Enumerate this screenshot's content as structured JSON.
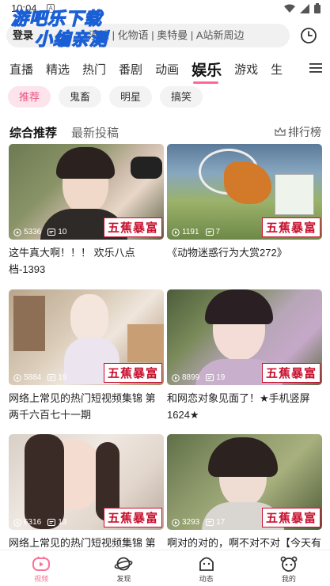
{
  "status_bar": {
    "time": "10:04",
    "notification_letter": "A"
  },
  "watermark": {
    "line1": "游吧乐下载",
    "line2": "小编亲测"
  },
  "search": {
    "login_label": "登录",
    "placeholder_text": "漫社 | 化物语 | 奥特曼 | A站新周边"
  },
  "nav_tabs": [
    "直播",
    "精选",
    "热门",
    "番剧",
    "动画",
    "娱乐",
    "游戏",
    "生"
  ],
  "active_nav_tab": "娱乐",
  "sub_tabs": [
    "推荐",
    "鬼畜",
    "明星",
    "搞笑"
  ],
  "section_tabs": [
    "综合推荐",
    "最新投稿"
  ],
  "rank_label": "排行榜",
  "cards": [
    {
      "views": "5336",
      "comments": "10",
      "brand": "五蕉暴富",
      "title_line1": "这牛真大啊！！！ 欢乐八点",
      "title_line2": "档-1393"
    },
    {
      "views": "1191",
      "comments": "7",
      "brand": "五蕉暴富",
      "title_line1": "《动物迷惑行为大赏272》",
      "title_line2": ""
    },
    {
      "views": "5884",
      "comments": "19",
      "brand": "五蕉暴富",
      "title_line1": "网络上常见的热门短视频集锦  第",
      "title_line2": "两千六百七十一期"
    },
    {
      "views": "8899",
      "comments": "19",
      "brand": "五蕉暴富",
      "title_line1": "和网恋对象见面了！★手机竖屏",
      "title_line2": "1624★"
    },
    {
      "views": "6316",
      "comments": "13",
      "brand": "五蕉暴富",
      "title_line1": "网络上常见的热门短视频集锦  第",
      "title_line2": ""
    },
    {
      "views": "3293",
      "comments": "17",
      "brand": "五蕉暴富",
      "title_line1": "啊对的对的，啊不对不对【今天有",
      "title_line2": ""
    }
  ],
  "bottom_tabs": [
    {
      "label": "视频",
      "icon": "video-tv-icon"
    },
    {
      "label": "发现",
      "icon": "planet-icon"
    },
    {
      "label": "动态",
      "icon": "ghost-face-icon"
    },
    {
      "label": "我的",
      "icon": "panda-face-icon"
    }
  ],
  "colors": {
    "accent": "#fb7299",
    "chip_active_bg": "#fde4ec",
    "brand_red": "#c8102e",
    "watermark_blue": "#1a5fd6"
  }
}
